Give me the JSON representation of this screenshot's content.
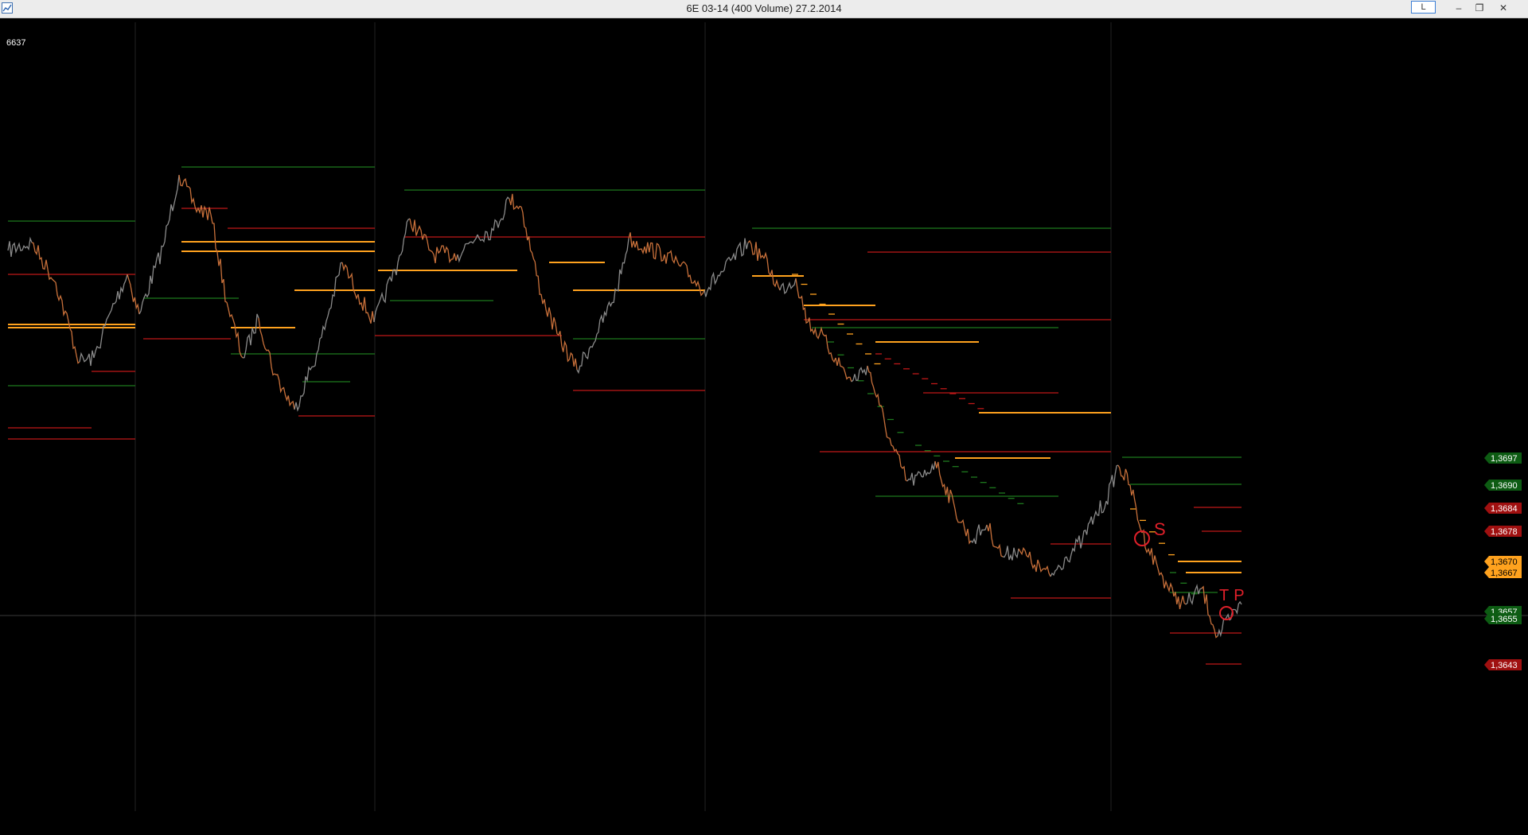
{
  "window": {
    "title": "6E 03-14 (400 Volume)  27.2.2014",
    "l_button": "L",
    "minimize": "–",
    "restore": "❐",
    "close": "✕"
  },
  "counter": "6637",
  "colors": {
    "background": "#000000",
    "green_level": "#1e7a1e",
    "red_level": "#c01818",
    "orange_level": "#ffa21e",
    "price_up": "#c8703a",
    "price_down": "#8a8a8a",
    "annotation": "#e0202a"
  },
  "chart_data": {
    "type": "line",
    "price_axis": {
      "labels": [
        {
          "value": "1,3697",
          "kind": "green"
        },
        {
          "value": "1,3690",
          "kind": "green"
        },
        {
          "value": "1,3684",
          "kind": "red"
        },
        {
          "value": "1,3678",
          "kind": "red"
        },
        {
          "value": "1,3670",
          "kind": "orange"
        },
        {
          "value": "1,3667",
          "kind": "orange"
        },
        {
          "value": "1,3657",
          "kind": "green"
        },
        {
          "value": "1,3655",
          "kind": "green"
        },
        {
          "value": "1,3643",
          "kind": "red"
        }
      ]
    },
    "annotations": [
      "S",
      "TP"
    ],
    "crosshair_price": "1,3657"
  }
}
